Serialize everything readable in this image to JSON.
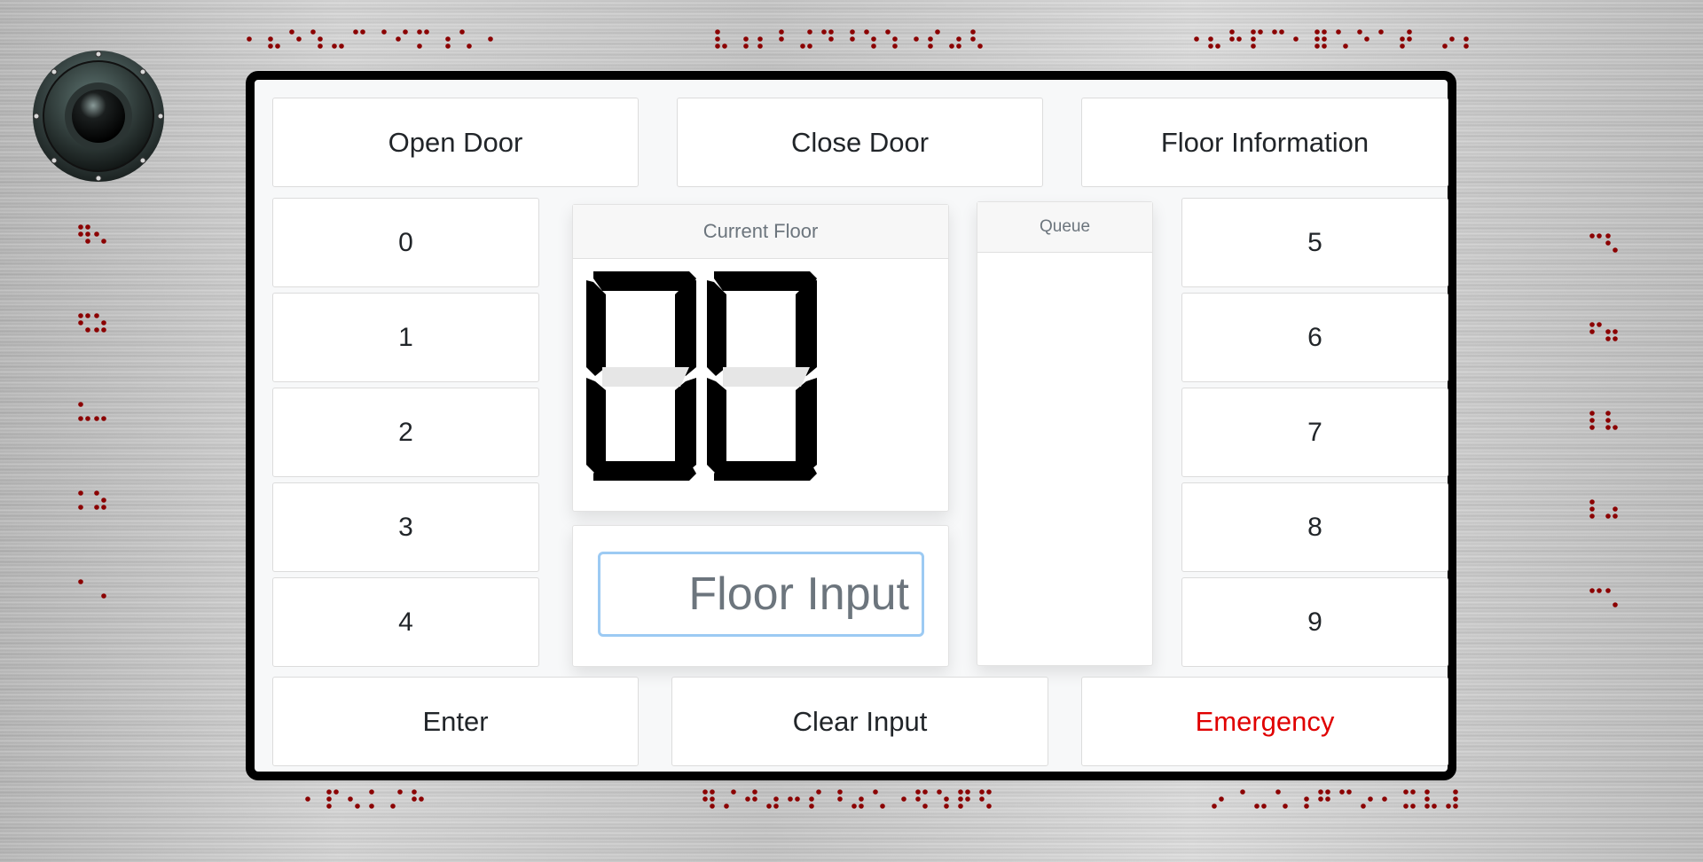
{
  "controls": {
    "open_door": "Open Door",
    "close_door": "Close Door",
    "floor_information": "Floor Information",
    "enter": "Enter",
    "clear_input": "Clear Input",
    "emergency": "Emergency"
  },
  "floor_buttons_left": [
    "0",
    "1",
    "2",
    "3",
    "4"
  ],
  "floor_buttons_right": [
    "5",
    "6",
    "7",
    "8",
    "9"
  ],
  "display": {
    "header": "Current Floor",
    "value": "00"
  },
  "queue": {
    "header": "Queue",
    "items": []
  },
  "input": {
    "placeholder": "Floor Input",
    "value": ""
  },
  "colors": {
    "frame": "#000000",
    "emergency_text": "#e00000",
    "braille_dots": "#8b0000",
    "input_focus_border": "#9ccaf3"
  },
  "icons": {
    "speaker": "speaker-icon"
  }
}
